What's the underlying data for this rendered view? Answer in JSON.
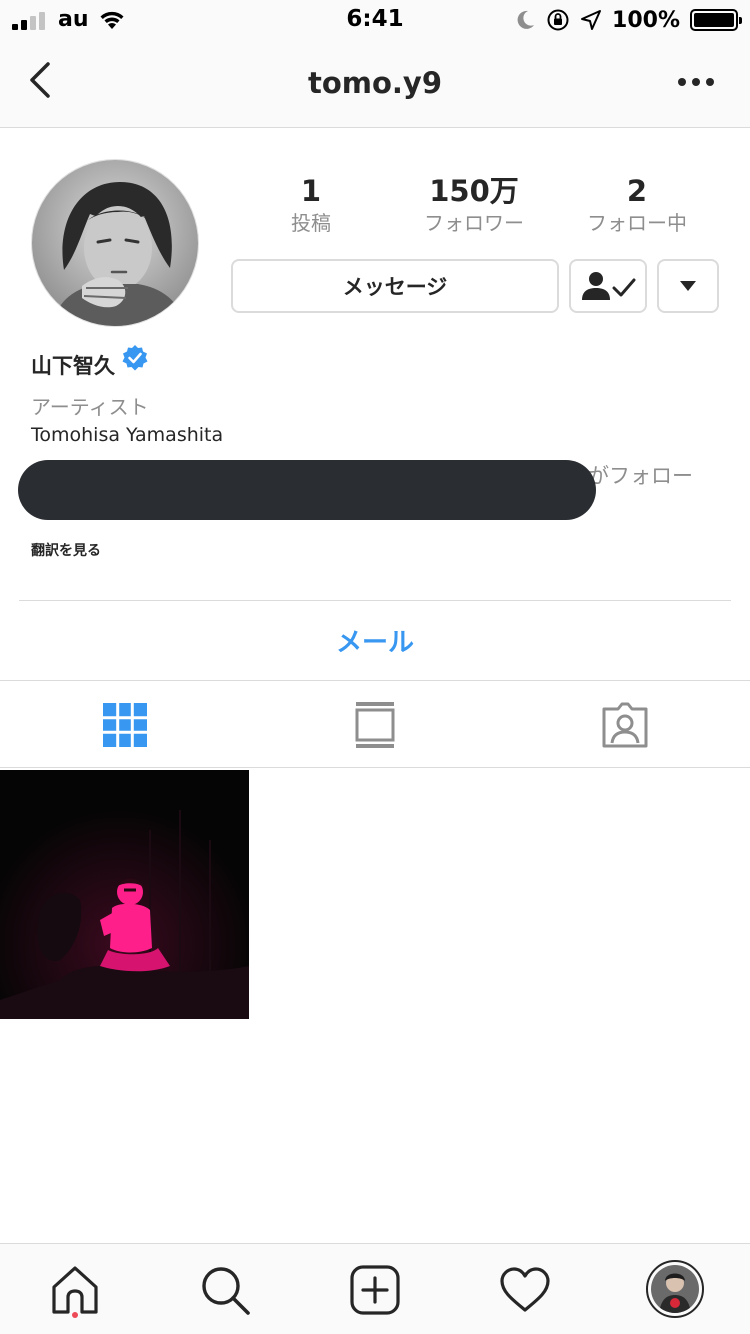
{
  "status_bar": {
    "carrier": "au",
    "time": "6:41",
    "battery_percent": "100%",
    "icons": [
      "signal-icon",
      "wifi-icon",
      "moon-icon",
      "rotation-lock-icon",
      "location-icon",
      "battery-icon"
    ]
  },
  "header": {
    "title": "tomo.y9",
    "icons": [
      "chevron-left-icon",
      "more-horizontal-icon"
    ]
  },
  "profile": {
    "stats": [
      {
        "value": "1",
        "label": "投稿"
      },
      {
        "value": "150万",
        "label": "フォロワー"
      },
      {
        "value": "2",
        "label": "フォロー中"
      }
    ],
    "message_button": "メッセージ",
    "display_name": "山下智久",
    "category": "アーティスト",
    "bio": "Tomohisa Yamashita",
    "followed_by_suffix": "がフォロー",
    "translate_link": "翻訳を見る",
    "email_button": "メール"
  },
  "tabs": [
    {
      "icon": "grid-icon",
      "active": true
    },
    {
      "icon": "feed-icon",
      "active": false
    },
    {
      "icon": "tagged-icon",
      "active": false
    }
  ],
  "tab_bar": {
    "icons": [
      "home-icon",
      "search-icon",
      "add-post-icon",
      "heart-icon",
      "profile-avatar"
    ],
    "notification_dot_color": "#ed4956"
  },
  "colors": {
    "accent_blue": "#3897f0",
    "text_primary": "#262626",
    "text_secondary": "#8e8e8e",
    "border": "#dbdbdb",
    "verified_blue": "#3897f0",
    "post_magenta": "#ff1f8a"
  }
}
